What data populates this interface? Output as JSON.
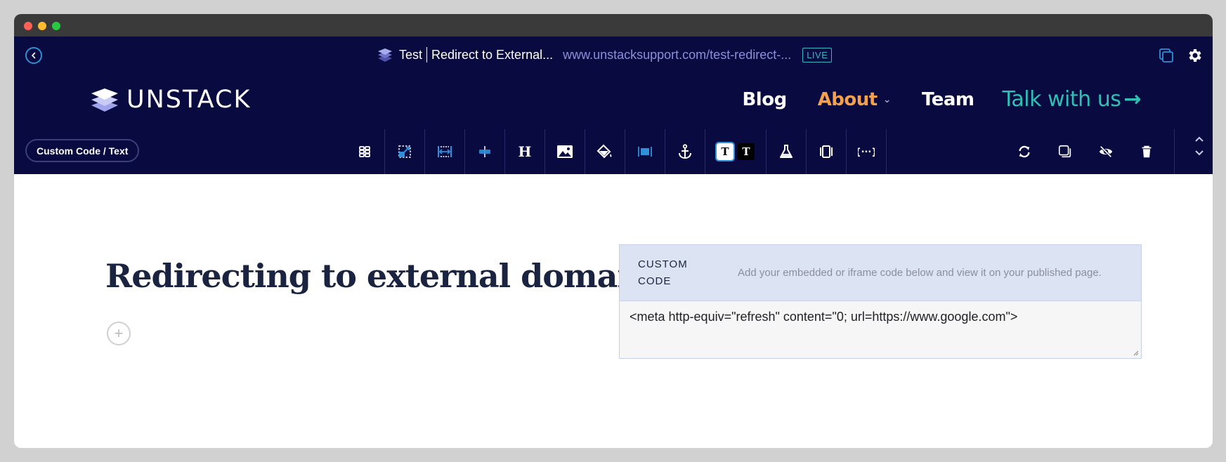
{
  "window": {
    "controls": [
      "close",
      "minimize",
      "maximize"
    ]
  },
  "topbar": {
    "back_icon": "chevron-left-circle-icon",
    "page_icon": "unstack-layers-icon",
    "page_prefix": "Test",
    "page_title": "Redirect to External...",
    "page_url": "www.unstacksupport.com/test-redirect-...",
    "status_badge": "LIVE",
    "right_icons": [
      "duplicate-window-icon",
      "gear-icon"
    ]
  },
  "sitenav": {
    "logo_text": "UNSTACK",
    "menu": [
      {
        "label": "Blog",
        "color": "#ffffff"
      },
      {
        "label": "About",
        "color": "#f5a04a",
        "has_dropdown": true
      },
      {
        "label": "Team",
        "color": "#ffffff"
      },
      {
        "label": "Talk with us",
        "color": "#2fbfb5",
        "arrow": "→"
      }
    ]
  },
  "toolbar": {
    "section_type": "Custom Code / Text",
    "tools": [
      {
        "name": "layout-columns-icon"
      },
      {
        "name": "resize-section-icon"
      },
      {
        "name": "full-width-icon"
      },
      {
        "name": "vertical-align-icon"
      },
      {
        "name": "heading-icon",
        "glyph": "H"
      },
      {
        "name": "image-icon"
      },
      {
        "name": "paint-bucket-icon"
      },
      {
        "name": "padding-icon"
      },
      {
        "name": "anchor-icon"
      },
      {
        "name": "text-theme-icon",
        "options": [
          "T",
          "T"
        ]
      },
      {
        "name": "flask-icon"
      },
      {
        "name": "carousel-icon"
      },
      {
        "name": "code-braces-icon",
        "glyph": "{···}"
      }
    ],
    "actions": [
      {
        "name": "refresh-icon"
      },
      {
        "name": "duplicate-icon"
      },
      {
        "name": "hide-icon"
      },
      {
        "name": "trash-icon"
      }
    ],
    "move_up": "chevron-up-icon",
    "move_down": "chevron-down-icon"
  },
  "canvas": {
    "heading": "Redirecting to external domain",
    "add_icon": "+",
    "custom_code": {
      "label_line1": "CUSTOM",
      "label_line2": "CODE",
      "description": "Add your embedded or iframe code below and view it on your published page.",
      "value": "<meta http-equiv=\"refresh\" content=\"0; url=https://www.google.com\">"
    }
  },
  "colors": {
    "navy": "#080a40",
    "accent_blue": "#2f8fd8",
    "live": "#36b7c9",
    "about": "#f5a04a",
    "cta": "#2fbfb5",
    "heading": "#1a2440"
  }
}
